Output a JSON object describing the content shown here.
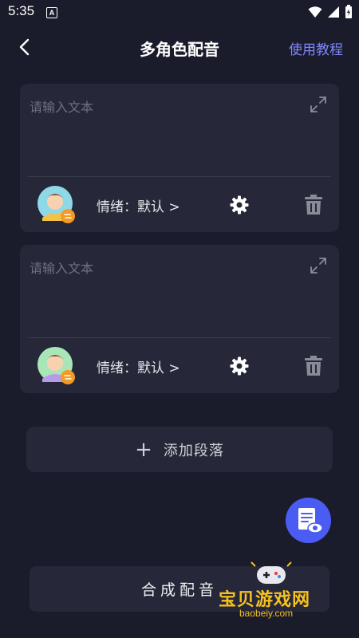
{
  "status_bar": {
    "time": "5:35",
    "notification_letter": "A"
  },
  "header": {
    "title": "多角色配音",
    "tutorial_link": "使用教程"
  },
  "cards": [
    {
      "placeholder": "请输入文本",
      "emotion_text": "情绪：默认 >",
      "avatar_color": "#8fd8e8"
    },
    {
      "placeholder": "请输入文本",
      "emotion_text": "情绪：默认 >",
      "avatar_color": "#a8e6b8"
    }
  ],
  "add_paragraph": {
    "icon": "+",
    "label": "添加段落"
  },
  "synthesize": {
    "label": "合成配音"
  },
  "watermark": {
    "text": "宝贝游戏网",
    "url": "baobeiy.com"
  },
  "colors": {
    "background": "#1b1c2b",
    "card": "#262738",
    "accent": "#7f86ff",
    "fab": "#4a5cf2"
  },
  "icons": [
    "back-arrow-icon",
    "expand-icon",
    "gear-icon",
    "trash-icon",
    "document-preview-icon",
    "plus-icon"
  ]
}
